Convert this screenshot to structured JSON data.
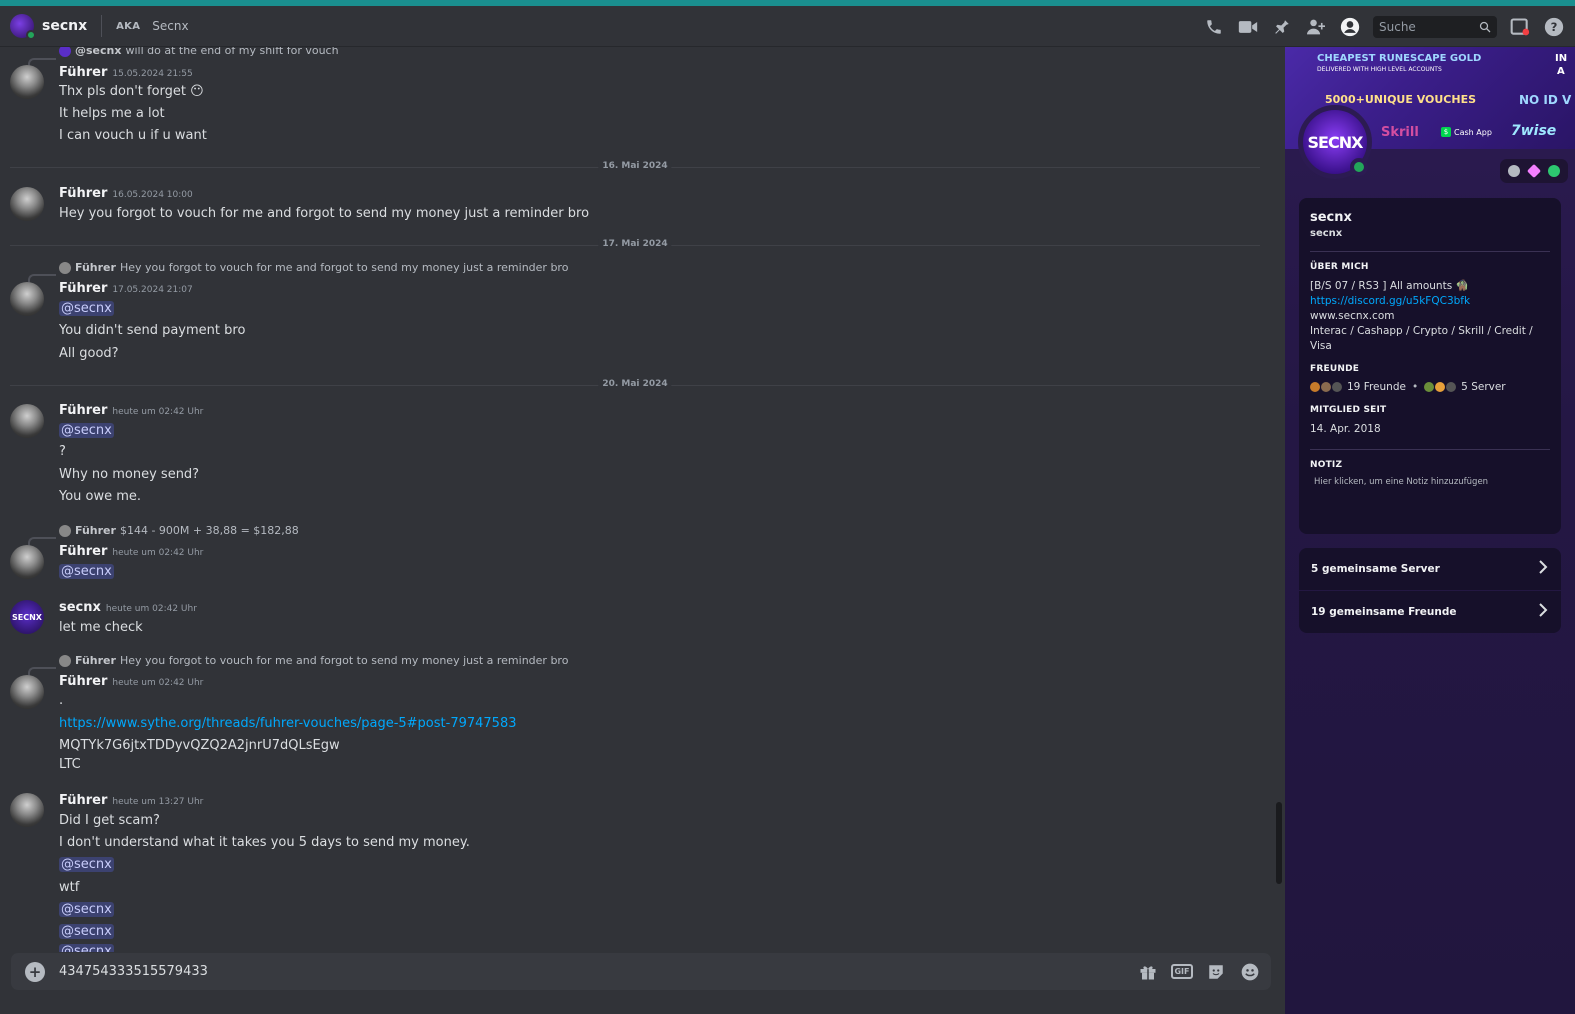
{
  "header": {
    "title": "secnx",
    "aka_label": "AKA",
    "aka_name": "Secnx",
    "search_placeholder": "Suche"
  },
  "messages": {
    "m1": {
      "reply_name": "@secnx",
      "reply_text": "will do at the end of my shift for vouch",
      "author": "Führer",
      "timestamp": "15.05.2024 21:55",
      "lines": [
        "Thx pls don't forget",
        "It helps me a lot",
        "I can vouch u if u want"
      ],
      "emoji": "😶"
    },
    "div1": "16. Mai 2024",
    "m2": {
      "author": "Führer",
      "timestamp": "16.05.2024 10:00",
      "lines": [
        "Hey you forgot to vouch for me and forgot to send my money just a reminder bro"
      ]
    },
    "div2": "17. Mai 2024",
    "m3": {
      "reply_name": "Führer",
      "reply_text": "Hey you forgot to vouch for me and forgot to send my money just a reminder bro",
      "author": "Führer",
      "timestamp": "17.05.2024 21:07",
      "mention": "@secnx",
      "lines": [
        "You didn't send payment bro",
        "All good?"
      ]
    },
    "div3": "20. Mai 2024",
    "m4": {
      "author": "Führer",
      "timestamp": "heute um 02:42 Uhr",
      "mention": "@secnx",
      "lines": [
        "?",
        "Why no money send?",
        "You owe me."
      ]
    },
    "m5": {
      "reply_name": "Führer",
      "reply_text": "$144 - 900M + 38,88 = $182,88",
      "author": "Führer",
      "timestamp": "heute um 02:42 Uhr",
      "mention": "@secnx"
    },
    "m6": {
      "author": "secnx",
      "timestamp": "heute um 02:42 Uhr",
      "lines": [
        "let me check"
      ]
    },
    "m7": {
      "reply_name": "Führer",
      "reply_text": "Hey you forgot to vouch for me and forgot to send my money just a reminder bro",
      "author": "Führer",
      "timestamp": "heute um 02:42 Uhr",
      "dot": ".",
      "link": "https://www.sythe.org/threads/fuhrer-vouches/page-5#post-79747583",
      "lines": [
        "MQTYk7G6jtxTDDyvQZQ2A2jnrU7dQLsEgw",
        "LTC"
      ]
    },
    "m8": {
      "author": "Führer",
      "timestamp": "heute um 13:27 Uhr",
      "lines": [
        "Did I get scam?",
        "I don't understand what it takes you 5 days to send my money.",
        "wtf"
      ],
      "mention": "@secnx"
    }
  },
  "composer": {
    "value": "434754333515579433"
  },
  "profile": {
    "banner": {
      "line1": "CHEAPEST RUNESCAPE GOLD",
      "line2": "DELIVERED WITH HIGH LEVEL ACCOUNTS",
      "line3a": "IN",
      "line3b": "A",
      "vouches": "5000+UNIQUE VOUCHES",
      "noid": "NO ID V",
      "skrill": "Skrill",
      "cashapp": "Cash App",
      "wise": "7wise",
      "avatar_text": "SECNX"
    },
    "display_name": "secnx",
    "username": "secnx",
    "about_label": "ÜBER MICH",
    "about_line1": "[B/S 07 / RS3 ] All amounts",
    "about_link": "https://discord.gg/u5kFQC3bfk",
    "about_line3": "www.secnx.com",
    "about_line4": "Interac / Cashapp  / Crypto / Skrill / Credit / Visa",
    "friends_label": "FREUNDE",
    "friends_count": "19 Freunde",
    "servers_count": "5 Server",
    "member_label": "MITGLIED SEIT",
    "member_since": "14. Apr. 2018",
    "note_label": "NOTIZ",
    "note_placeholder": "Hier klicken, um eine Notiz hinzuzufügen",
    "mutual_servers": "5 gemeinsame Server",
    "mutual_friends": "19 gemeinsame Freunde"
  }
}
